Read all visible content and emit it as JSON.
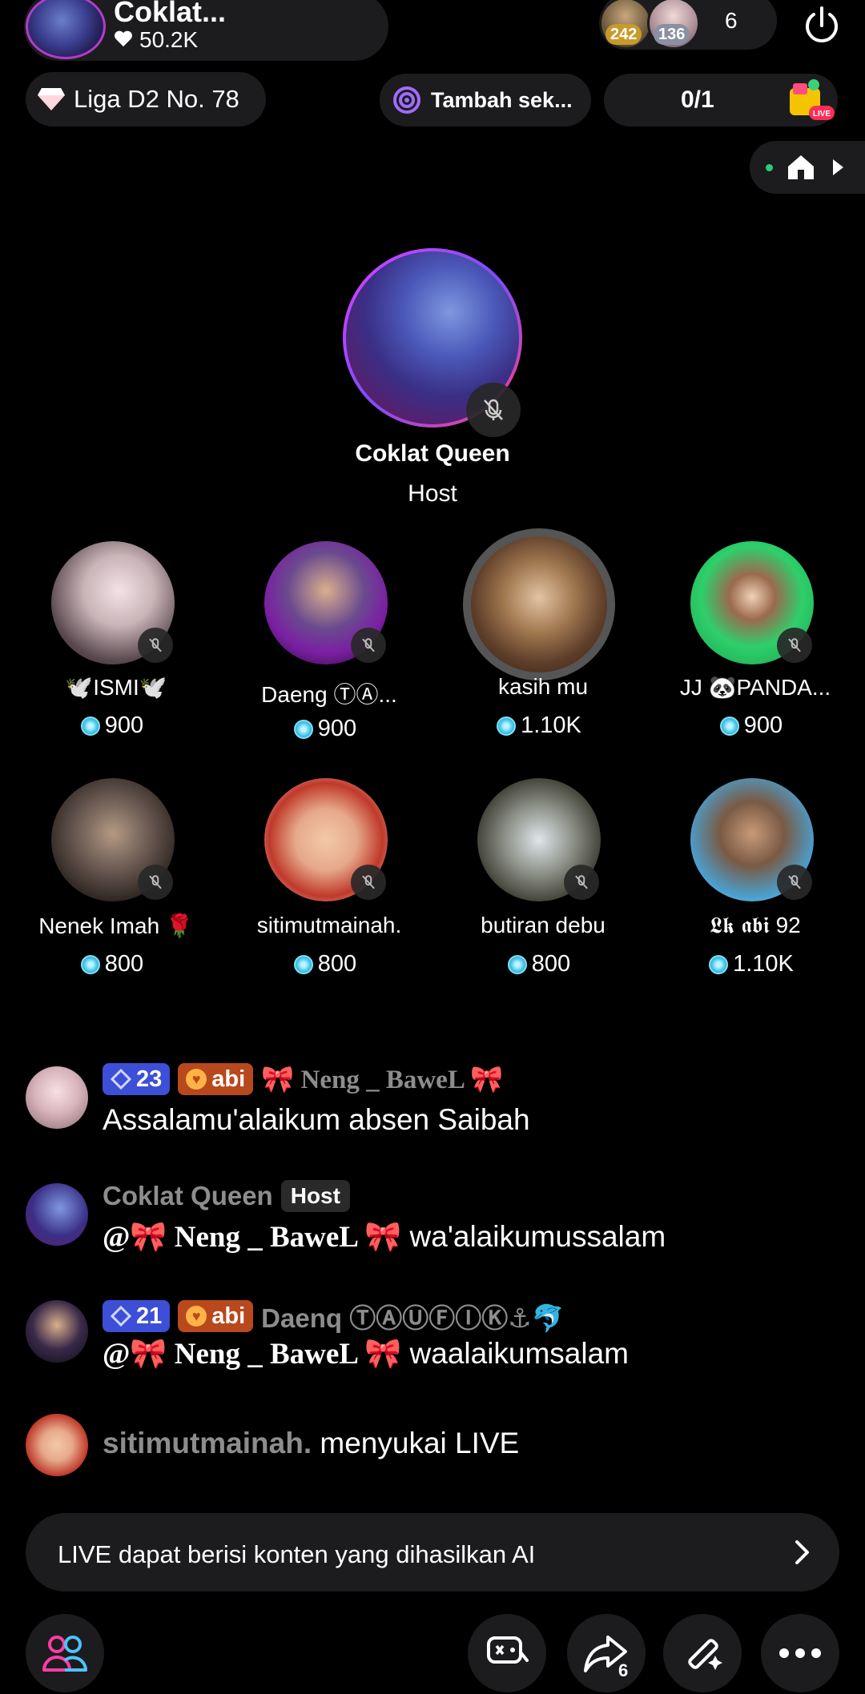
{
  "header": {
    "host_name": "Coklat...",
    "host_likes": "50.2K",
    "viewer_badge_1": "242",
    "viewer_badge_2": "136",
    "viewer_count": "6"
  },
  "chips": {
    "league": "Liga D2 No. 78",
    "task": "Tambah sek...",
    "goal": "0/1"
  },
  "stage": {
    "host_name": "Coklat Queen",
    "host_role": "Host"
  },
  "guests": [
    {
      "name": "🕊️ISMI🕊️",
      "score": "900"
    },
    {
      "name": "Daeng ⓉⒶ...",
      "score": "900"
    },
    {
      "name": "kasih mu",
      "score": "1.10K"
    },
    {
      "name": "JJ 🐼PANDA...",
      "score": "900"
    },
    {
      "name": "Nenek Imah 🌹",
      "score": "800"
    },
    {
      "name": "sitimutmainah.",
      "score": "800"
    },
    {
      "name": "butiran debu",
      "score": "800"
    },
    {
      "name": "𝕷𝖐 𝖆𝖇𝖎 92",
      "score": "1.10K"
    }
  ],
  "chat": [
    {
      "level": "23",
      "fan": "abi",
      "user": "🎀 Neng _ BaweL 🎀",
      "text": "Assalamu'alaikum absen Saibah"
    },
    {
      "user": "Coklat Queen",
      "tag": "Host",
      "text_prefix": "@🎀 Neng _ BaweL 🎀",
      "text": "wa'alaikumussalam"
    },
    {
      "level": "21",
      "fan": "abi",
      "user": "Daenq ⓉⒶⓊⒻⒾⓀ⚓🐬",
      "text_prefix": "@🎀 Neng _ BaweL 🎀",
      "text": "waalaikumsalam"
    },
    {
      "user": "sitimutmainah.",
      "text": "menyukai LIVE"
    }
  ],
  "notice": {
    "text": "LIVE dapat berisi konten yang dihasilkan AI"
  },
  "bottom": {
    "share_count": "6"
  },
  "icons": [
    "heart-icon",
    "power-icon",
    "diamond-icon",
    "target-icon",
    "live-gift-icon",
    "home-icon",
    "mic-off-icon",
    "coin-icon",
    "chevron-right-icon",
    "people-icon",
    "gamepad-icon",
    "share-icon",
    "magic-wand-icon",
    "more-icon"
  ],
  "colors": {
    "accent_pink": "#e040fb",
    "level_badge": "#3d4fd6",
    "fan_badge": "#b8491c",
    "pill_bg": "#1c1c1e"
  }
}
